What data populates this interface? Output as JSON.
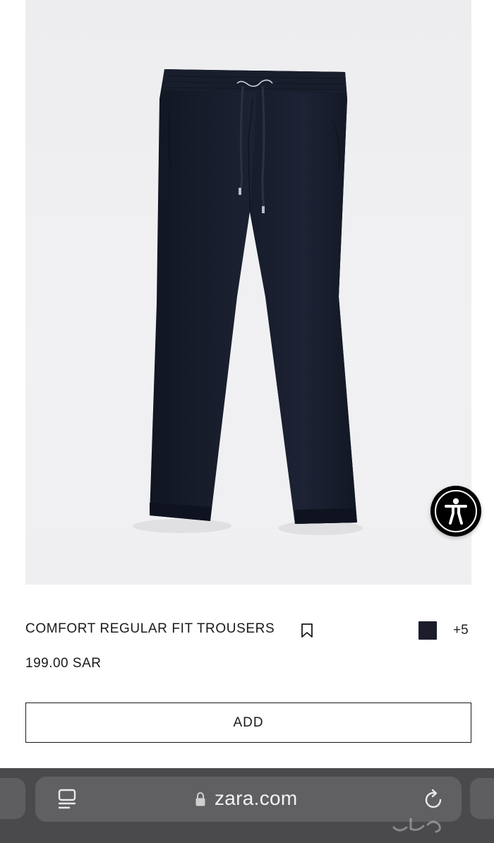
{
  "product": {
    "title": "COMFORT REGULAR FIT TROUSERS",
    "price": "199.00 SAR",
    "color_swatch": "#1b1d2b",
    "more_colors": "+5",
    "add_label": "ADD",
    "image_icon": "trousers-image",
    "bookmark_icon": "bookmark-icon"
  },
  "accessibility": {
    "icon": "accessibility-icon"
  },
  "browser": {
    "url": "zara.com",
    "tabs_icon": "tabs-icon",
    "lock_icon": "lock-icon",
    "reload_icon": "reload-icon"
  }
}
